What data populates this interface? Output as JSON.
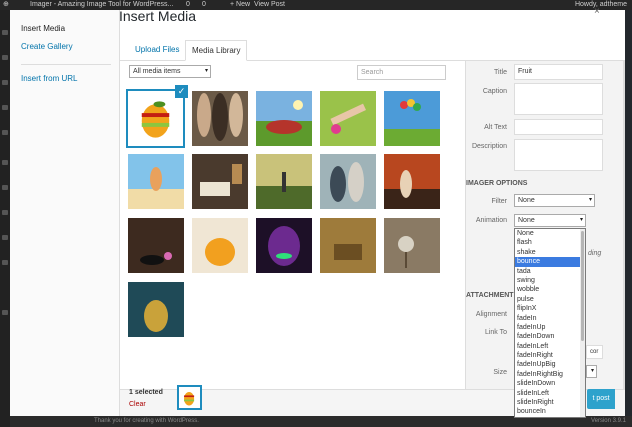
{
  "admin_bar": {
    "site_title": "Imager - Amazing Image Tool for WordPress...",
    "updates": "0",
    "comments": "0",
    "new_label": "+ New",
    "view_post": "View Post",
    "howdy": "Howdy, adtheme"
  },
  "footer": {
    "thanks": "Thank you for creating with WordPress.",
    "version": "Version 3.9.1"
  },
  "modal": {
    "title": "Insert Media",
    "close": "×",
    "menu": {
      "insert_media": "Insert Media",
      "create_gallery": "Create Gallery",
      "insert_from_url": "Insert from URL"
    },
    "tabs": {
      "upload": "Upload Files",
      "library": "Media Library"
    },
    "filter": {
      "value": "All media items"
    },
    "search": {
      "placeholder": "Search"
    },
    "details": {
      "title_label": "Title",
      "title_value": "Fruit",
      "caption_label": "Caption",
      "alt_label": "Alt Text",
      "description_label": "Description",
      "imager_section": "IMAGER OPTIONS",
      "filter_label": "Filter",
      "filter_value": "None",
      "animation_label": "Animation",
      "animation_value": "None",
      "attachment_section": "ATTACHMENT D",
      "alignment_label": "Alignment",
      "link_label": "Link To",
      "size_label": "Size",
      "loading_text": "ding",
      "url_fragment": "cor"
    },
    "animation_options": [
      "None",
      "flash",
      "shake",
      "bounce",
      "tada",
      "swing",
      "wobble",
      "pulse",
      "flipInX",
      "fadeIn",
      "fadeInUp",
      "fadeInDown",
      "fadeInLeft",
      "fadeInRight",
      "fadeInUpBig",
      "fadeInRightBig",
      "slideInDown",
      "slideInLeft",
      "slideInRight",
      "bounceIn"
    ],
    "animation_highlighted": "bounce",
    "toolbar": {
      "selected": "1 selected",
      "clear": "Clear",
      "insert": "t post"
    },
    "thumbnails": [
      "fruit",
      "crowd",
      "picnic",
      "legs",
      "balloons",
      "beach",
      "bedroom",
      "sunrise",
      "walkers",
      "portrait",
      "diner",
      "spa",
      "jellyfish",
      "neon-face",
      "tea-party",
      "dandelion",
      "mermaid"
    ],
    "selected_thumbnail": "fruit"
  },
  "colors": {
    "accent": "#1e8cbe",
    "link": "#0073aa",
    "danger": "#aa0000",
    "highlight": "#3b7be0"
  }
}
